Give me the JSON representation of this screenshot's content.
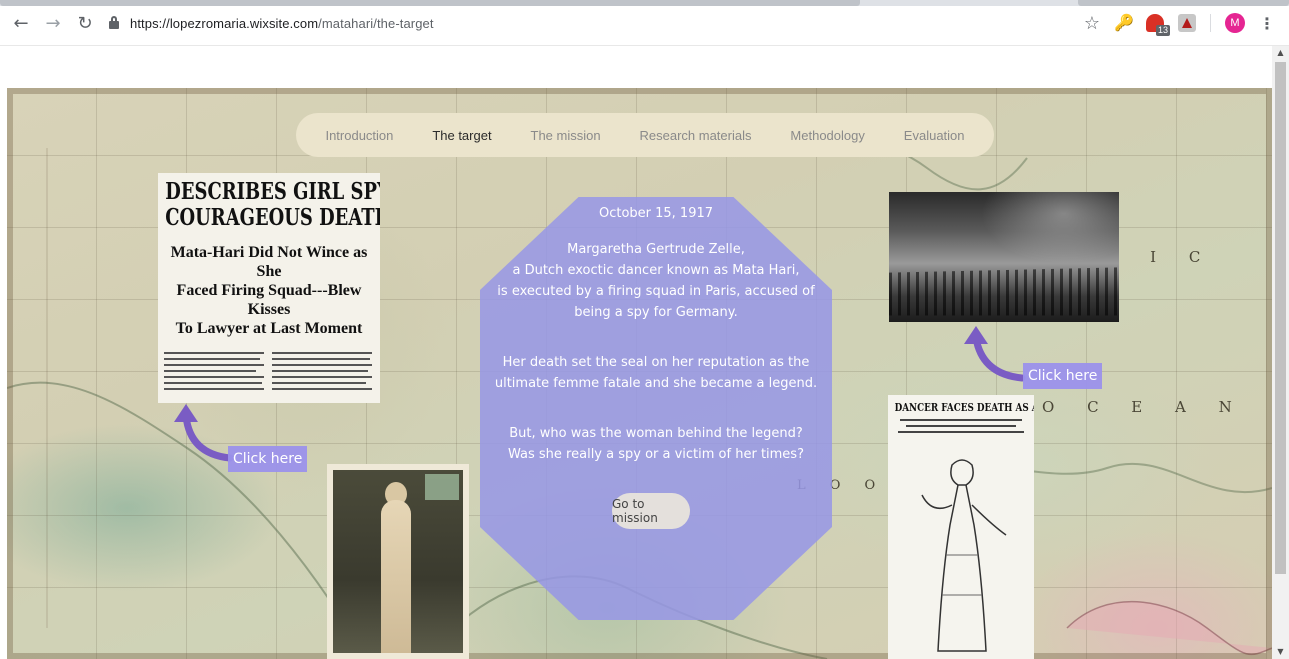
{
  "browser": {
    "url_host": "https://lopezromaria.wixsite.com",
    "url_path": "/matahari/the-target",
    "avatar_initial": "M",
    "mail_badge": "13",
    "icons": [
      "back-icon",
      "forward-icon",
      "reload-icon",
      "lock-icon",
      "star-icon",
      "key-extension-icon",
      "mail-extension-icon",
      "pdf-extension-icon",
      "menu-icon"
    ]
  },
  "nav": {
    "items": [
      {
        "label": "Introduction"
      },
      {
        "label": "The target"
      },
      {
        "label": "The mission"
      },
      {
        "label": "Research materials"
      },
      {
        "label": "Methodology"
      },
      {
        "label": "Evaluation"
      }
    ],
    "active": "The target"
  },
  "panel": {
    "date": "October 15, 1917",
    "p1_line1": "Margaretha Gertrude Zelle,",
    "p1_line2": "a Dutch exoctic dancer known as Mata Hari,",
    "p1_line3": "is executed by a firing squad in Paris, accused of",
    "p1_line4": "being a spy for Germany.",
    "p2_line1": "Her death set the seal on her reputation as the",
    "p2_line2": "ultimate femme fatale and she became a legend.",
    "p3_line1": "But, who was the woman behind the legend?",
    "p3_line2": "Was she really a spy or a victim of her times?",
    "button": "Go to mission"
  },
  "clipping1": {
    "headline_line1": "DESCRIBES GIRL SPY'S",
    "headline_line2": "COURAGEOUS DEATH",
    "sub_line1": "Mata-Hari Did Not Wince as She",
    "sub_line2": "Faced Firing Squad---Blew Kisses",
    "sub_line3": "To Lawyer at Last Moment"
  },
  "clipping2": {
    "headline": "DANCER FACES DEATH AS A SPY"
  },
  "links": {
    "click_left": "Click here",
    "click_right": "Click here"
  },
  "map_labels": {
    "right_top": "F I C",
    "right_mid": "O C E A N",
    "bottom": "L O O  S E"
  },
  "colors": {
    "panel": "#9696e6",
    "nav_bg": "#ebe4cc",
    "click_label": "#9b91eb",
    "arrow": "#7a5cc4"
  }
}
